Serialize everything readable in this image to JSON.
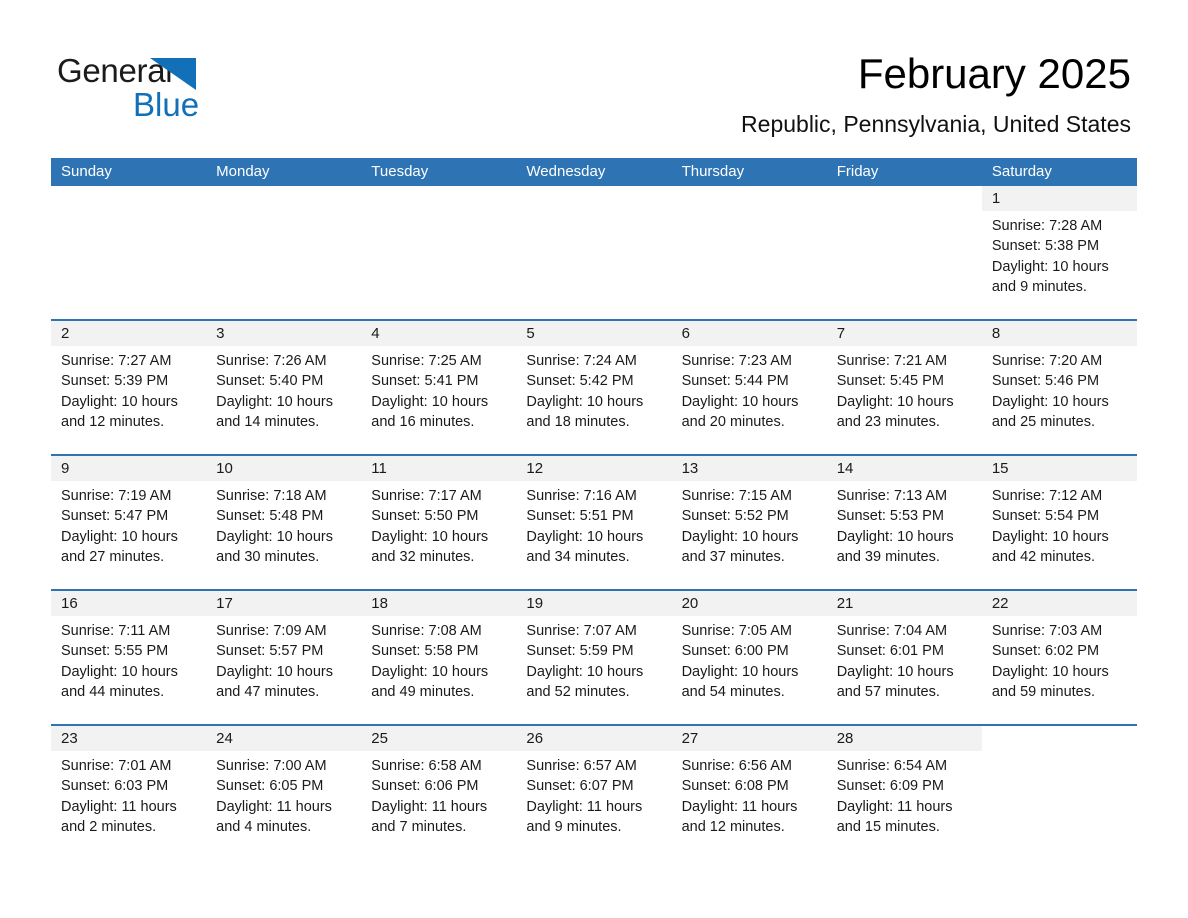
{
  "brand": {
    "name_part1": "General",
    "name_part2": "Blue",
    "accent_color": "#1170b8"
  },
  "header": {
    "title": "February 2025",
    "subtitle": "Republic, Pennsylvania, United States"
  },
  "calendar": {
    "header_bg": "#2e74b5",
    "daynum_bg": "#f2f2f2",
    "weekday_headers": [
      "Sunday",
      "Monday",
      "Tuesday",
      "Wednesday",
      "Thursday",
      "Friday",
      "Saturday"
    ],
    "weeks": [
      [
        {
          "day": "",
          "sunrise": "",
          "sunset": "",
          "daylight": "",
          "blank": true
        },
        {
          "day": "",
          "sunrise": "",
          "sunset": "",
          "daylight": "",
          "blank": true
        },
        {
          "day": "",
          "sunrise": "",
          "sunset": "",
          "daylight": "",
          "blank": true
        },
        {
          "day": "",
          "sunrise": "",
          "sunset": "",
          "daylight": "",
          "blank": true
        },
        {
          "day": "",
          "sunrise": "",
          "sunset": "",
          "daylight": "",
          "blank": true
        },
        {
          "day": "",
          "sunrise": "",
          "sunset": "",
          "daylight": "",
          "blank": true
        },
        {
          "day": "1",
          "sunrise": "Sunrise: 7:28 AM",
          "sunset": "Sunset: 5:38 PM",
          "daylight": "Daylight: 10 hours and 9 minutes.",
          "blank": false
        }
      ],
      [
        {
          "day": "2",
          "sunrise": "Sunrise: 7:27 AM",
          "sunset": "Sunset: 5:39 PM",
          "daylight": "Daylight: 10 hours and 12 minutes.",
          "blank": false
        },
        {
          "day": "3",
          "sunrise": "Sunrise: 7:26 AM",
          "sunset": "Sunset: 5:40 PM",
          "daylight": "Daylight: 10 hours and 14 minutes.",
          "blank": false
        },
        {
          "day": "4",
          "sunrise": "Sunrise: 7:25 AM",
          "sunset": "Sunset: 5:41 PM",
          "daylight": "Daylight: 10 hours and 16 minutes.",
          "blank": false
        },
        {
          "day": "5",
          "sunrise": "Sunrise: 7:24 AM",
          "sunset": "Sunset: 5:42 PM",
          "daylight": "Daylight: 10 hours and 18 minutes.",
          "blank": false
        },
        {
          "day": "6",
          "sunrise": "Sunrise: 7:23 AM",
          "sunset": "Sunset: 5:44 PM",
          "daylight": "Daylight: 10 hours and 20 minutes.",
          "blank": false
        },
        {
          "day": "7",
          "sunrise": "Sunrise: 7:21 AM",
          "sunset": "Sunset: 5:45 PM",
          "daylight": "Daylight: 10 hours and 23 minutes.",
          "blank": false
        },
        {
          "day": "8",
          "sunrise": "Sunrise: 7:20 AM",
          "sunset": "Sunset: 5:46 PM",
          "daylight": "Daylight: 10 hours and 25 minutes.",
          "blank": false
        }
      ],
      [
        {
          "day": "9",
          "sunrise": "Sunrise: 7:19 AM",
          "sunset": "Sunset: 5:47 PM",
          "daylight": "Daylight: 10 hours and 27 minutes.",
          "blank": false
        },
        {
          "day": "10",
          "sunrise": "Sunrise: 7:18 AM",
          "sunset": "Sunset: 5:48 PM",
          "daylight": "Daylight: 10 hours and 30 minutes.",
          "blank": false
        },
        {
          "day": "11",
          "sunrise": "Sunrise: 7:17 AM",
          "sunset": "Sunset: 5:50 PM",
          "daylight": "Daylight: 10 hours and 32 minutes.",
          "blank": false
        },
        {
          "day": "12",
          "sunrise": "Sunrise: 7:16 AM",
          "sunset": "Sunset: 5:51 PM",
          "daylight": "Daylight: 10 hours and 34 minutes.",
          "blank": false
        },
        {
          "day": "13",
          "sunrise": "Sunrise: 7:15 AM",
          "sunset": "Sunset: 5:52 PM",
          "daylight": "Daylight: 10 hours and 37 minutes.",
          "blank": false
        },
        {
          "day": "14",
          "sunrise": "Sunrise: 7:13 AM",
          "sunset": "Sunset: 5:53 PM",
          "daylight": "Daylight: 10 hours and 39 minutes.",
          "blank": false
        },
        {
          "day": "15",
          "sunrise": "Sunrise: 7:12 AM",
          "sunset": "Sunset: 5:54 PM",
          "daylight": "Daylight: 10 hours and 42 minutes.",
          "blank": false
        }
      ],
      [
        {
          "day": "16",
          "sunrise": "Sunrise: 7:11 AM",
          "sunset": "Sunset: 5:55 PM",
          "daylight": "Daylight: 10 hours and 44 minutes.",
          "blank": false
        },
        {
          "day": "17",
          "sunrise": "Sunrise: 7:09 AM",
          "sunset": "Sunset: 5:57 PM",
          "daylight": "Daylight: 10 hours and 47 minutes.",
          "blank": false
        },
        {
          "day": "18",
          "sunrise": "Sunrise: 7:08 AM",
          "sunset": "Sunset: 5:58 PM",
          "daylight": "Daylight: 10 hours and 49 minutes.",
          "blank": false
        },
        {
          "day": "19",
          "sunrise": "Sunrise: 7:07 AM",
          "sunset": "Sunset: 5:59 PM",
          "daylight": "Daylight: 10 hours and 52 minutes.",
          "blank": false
        },
        {
          "day": "20",
          "sunrise": "Sunrise: 7:05 AM",
          "sunset": "Sunset: 6:00 PM",
          "daylight": "Daylight: 10 hours and 54 minutes.",
          "blank": false
        },
        {
          "day": "21",
          "sunrise": "Sunrise: 7:04 AM",
          "sunset": "Sunset: 6:01 PM",
          "daylight": "Daylight: 10 hours and 57 minutes.",
          "blank": false
        },
        {
          "day": "22",
          "sunrise": "Sunrise: 7:03 AM",
          "sunset": "Sunset: 6:02 PM",
          "daylight": "Daylight: 10 hours and 59 minutes.",
          "blank": false
        }
      ],
      [
        {
          "day": "23",
          "sunrise": "Sunrise: 7:01 AM",
          "sunset": "Sunset: 6:03 PM",
          "daylight": "Daylight: 11 hours and 2 minutes.",
          "blank": false
        },
        {
          "day": "24",
          "sunrise": "Sunrise: 7:00 AM",
          "sunset": "Sunset: 6:05 PM",
          "daylight": "Daylight: 11 hours and 4 minutes.",
          "blank": false
        },
        {
          "day": "25",
          "sunrise": "Sunrise: 6:58 AM",
          "sunset": "Sunset: 6:06 PM",
          "daylight": "Daylight: 11 hours and 7 minutes.",
          "blank": false
        },
        {
          "day": "26",
          "sunrise": "Sunrise: 6:57 AM",
          "sunset": "Sunset: 6:07 PM",
          "daylight": "Daylight: 11 hours and 9 minutes.",
          "blank": false
        },
        {
          "day": "27",
          "sunrise": "Sunrise: 6:56 AM",
          "sunset": "Sunset: 6:08 PM",
          "daylight": "Daylight: 11 hours and 12 minutes.",
          "blank": false
        },
        {
          "day": "28",
          "sunrise": "Sunrise: 6:54 AM",
          "sunset": "Sunset: 6:09 PM",
          "daylight": "Daylight: 11 hours and 15 minutes.",
          "blank": false
        },
        {
          "day": "",
          "sunrise": "",
          "sunset": "",
          "daylight": "",
          "blank": true
        }
      ]
    ]
  }
}
